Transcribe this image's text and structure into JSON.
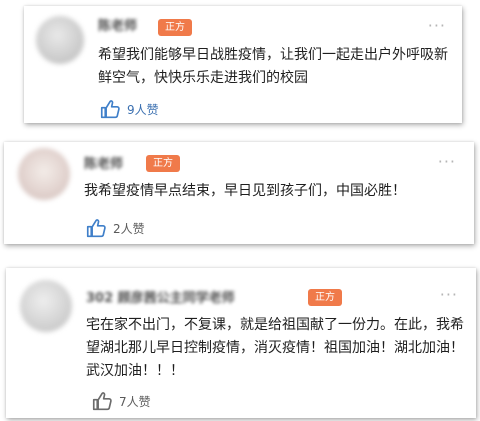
{
  "comments": [
    {
      "author": "陈老师",
      "badge": "正方",
      "more": "···",
      "text": "希望我们能够早日战胜疫情，让我们一起走出户外呼吸新鲜空气，快快乐乐走进我们的校园",
      "likes": "9人赞",
      "like_icon": "thumbs-up-icon"
    },
    {
      "author": "陈老师",
      "badge": "正方",
      "more": "···",
      "text": "我希望疫情早点结束，早日见到孩子们，中国必胜！",
      "likes": "2人赞",
      "like_icon": "thumbs-up-icon"
    },
    {
      "author": "302 顾彦茜公主同学老师",
      "badge": "正方",
      "more": "···",
      "text": "宅在家不出门，不复课，就是给祖国献了一份力。在此，我希望湖北那儿早日控制疫情，消灭疫情！祖国加油！湖北加油！武汉加油！！！",
      "likes": "7人赞",
      "like_icon": "thumbs-up-icon"
    }
  ],
  "colors": {
    "badge": "#f07a4a",
    "like_active": "#3a6fb0",
    "like_icon_blue": "#3f7fc9",
    "like_icon_gray": "#6b6b6b"
  }
}
